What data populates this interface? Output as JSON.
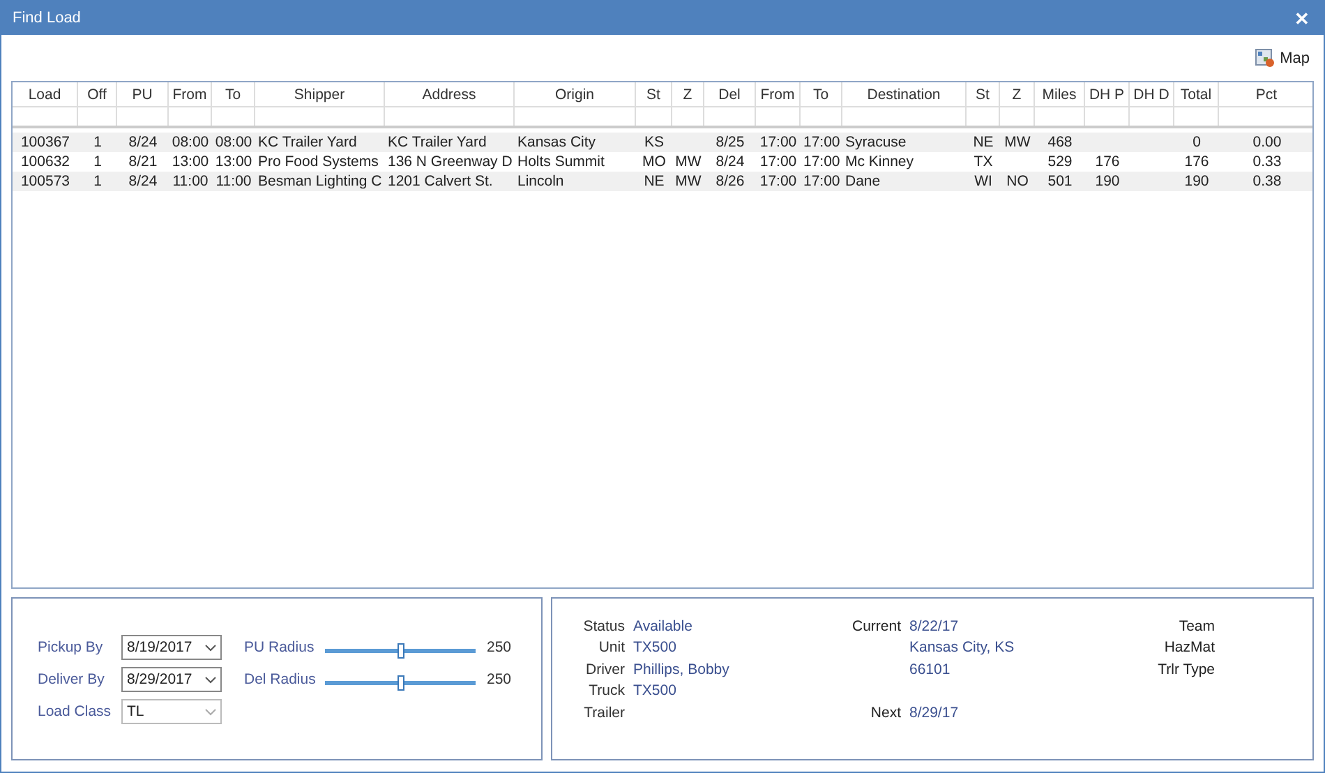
{
  "window": {
    "title": "Find Load",
    "close": "✕"
  },
  "toolbar": {
    "map_button": "Map"
  },
  "table": {
    "columns": [
      {
        "label": "Load"
      },
      {
        "label": "Off"
      },
      {
        "label": "PU"
      },
      {
        "label": "From"
      },
      {
        "label": "To"
      },
      {
        "label": "Shipper"
      },
      {
        "label": "Address"
      },
      {
        "label": "Origin"
      },
      {
        "label": "St"
      },
      {
        "label": "Z"
      },
      {
        "label": "Del"
      },
      {
        "label": "From"
      },
      {
        "label": "To"
      },
      {
        "label": "Destination"
      },
      {
        "label": "St"
      },
      {
        "label": "Z"
      },
      {
        "label": "Miles"
      },
      {
        "label": "DH P"
      },
      {
        "label": "DH D"
      },
      {
        "label": "Total"
      },
      {
        "label": "Pct"
      }
    ],
    "rows": [
      [
        "100367",
        "1",
        "8/24",
        "08:00",
        "08:00",
        "KC Trailer Yard",
        "KC Trailer Yard",
        "Kansas City",
        "KS",
        "",
        "8/25",
        "17:00",
        "17:00",
        "Syracuse",
        "NE",
        "MW",
        "468",
        "",
        "",
        "0",
        "0.00"
      ],
      [
        "100632",
        "1",
        "8/21",
        "13:00",
        "13:00",
        "Pro Food Systems",
        "136 N Greenway D",
        "Holts Summit",
        "MO",
        "MW",
        "8/24",
        "17:00",
        "17:00",
        "Mc Kinney",
        "TX",
        "",
        "529",
        "176",
        "",
        "176",
        "0.33"
      ],
      [
        "100573",
        "1",
        "8/24",
        "11:00",
        "11:00",
        "Besman Lighting C",
        "1201 Calvert St.",
        "Lincoln",
        "NE",
        "MW",
        "8/26",
        "17:00",
        "17:00",
        "Dane",
        "WI",
        "NO",
        "501",
        "190",
        "",
        "190",
        "0.38"
      ]
    ]
  },
  "filters": {
    "pickup_by": {
      "label": "Pickup By",
      "value": "8/19/2017"
    },
    "deliver_by": {
      "label": "Deliver By",
      "value": "8/29/2017"
    },
    "load_class": {
      "label": "Load Class",
      "value": "TL"
    },
    "sliders": [
      {
        "label": "PU Radius",
        "level": 0.5,
        "reading": "250"
      },
      {
        "label": "Del Radius",
        "level": 0.5,
        "reading": "250"
      }
    ]
  },
  "details": {
    "left": [
      {
        "label": "Status",
        "value": "Available"
      },
      {
        "label": "Unit",
        "value": "TX500"
      },
      {
        "label": "Driver",
        "value": "Phillips, Bobby"
      },
      {
        "label": "Truck",
        "value": "TX500"
      },
      {
        "label": "Trailer"
      }
    ],
    "middle": [
      {
        "label": "Current",
        "value": "8/22/17"
      },
      {
        "value": "Kansas City, KS"
      },
      {
        "value": "66101"
      }
    ],
    "next": {
      "label": "Next",
      "value": "8/29/17"
    },
    "right": [
      {
        "label": "Team"
      },
      {
        "label": "HazMat"
      },
      {
        "label": "Trlr Type"
      }
    ]
  }
}
